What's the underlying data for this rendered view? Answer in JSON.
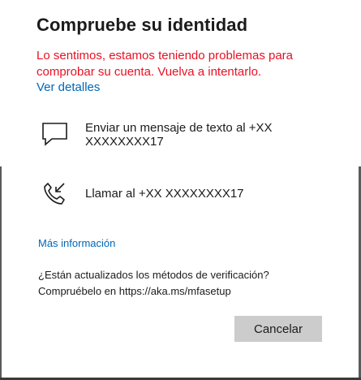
{
  "dialog": {
    "title": "Compruebe su identidad",
    "error_line1": "Lo sentimos, estamos teniendo problemas para",
    "error_line2": "comprobar su cuenta. Vuelva a intentarlo.",
    "details_link": "Ver detalles"
  },
  "options": [
    {
      "icon": "chat-message-icon",
      "line1": "Enviar un mensaje de texto al +XX",
      "line2": "XXXXXXXX17"
    },
    {
      "icon": "phone-call-icon",
      "label": "Llamar al +XX XXXXXXXX17"
    }
  ],
  "more_info_link": "Más información",
  "methods": {
    "line1": "¿Están actualizados los métodos de verificación?",
    "line2": "Compruébelo en https://aka.ms/mfasetup"
  },
  "buttons": {
    "cancel": "Cancelar"
  },
  "colors": {
    "error": "#e81123",
    "link": "#0067b8",
    "button_bg": "#cccccc"
  }
}
